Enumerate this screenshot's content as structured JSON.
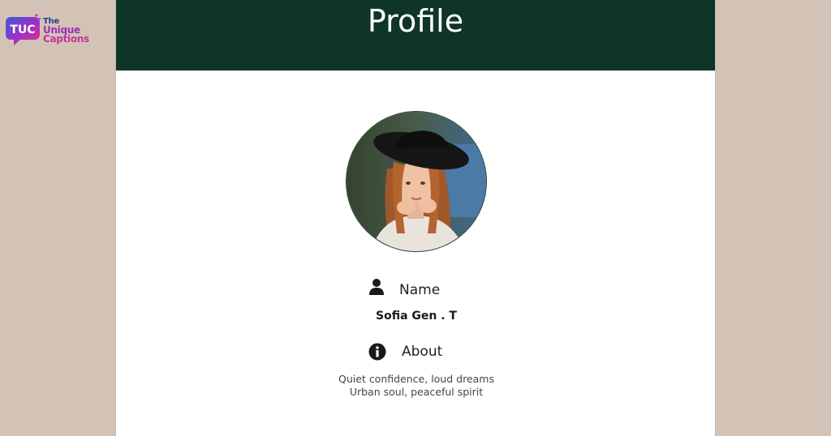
{
  "brand": {
    "badge_text": "TUC",
    "line1": "The",
    "line2": "Unique",
    "line3": "Captions"
  },
  "header": {
    "title": "Profile",
    "background": "#0f3526"
  },
  "profile": {
    "avatar_icon": "profile-photo",
    "name_icon": "person-icon",
    "name_label": "Name",
    "name_value": "Sofia Gen . T",
    "about_icon": "info-icon",
    "about_label": "About",
    "about_lines": [
      "Quiet confidence, loud dreams",
      "Urban soul, peaceful spirit"
    ]
  },
  "colors": {
    "page_background": "#d3c3b6",
    "card_background": "#ffffff",
    "text": "#222222"
  }
}
